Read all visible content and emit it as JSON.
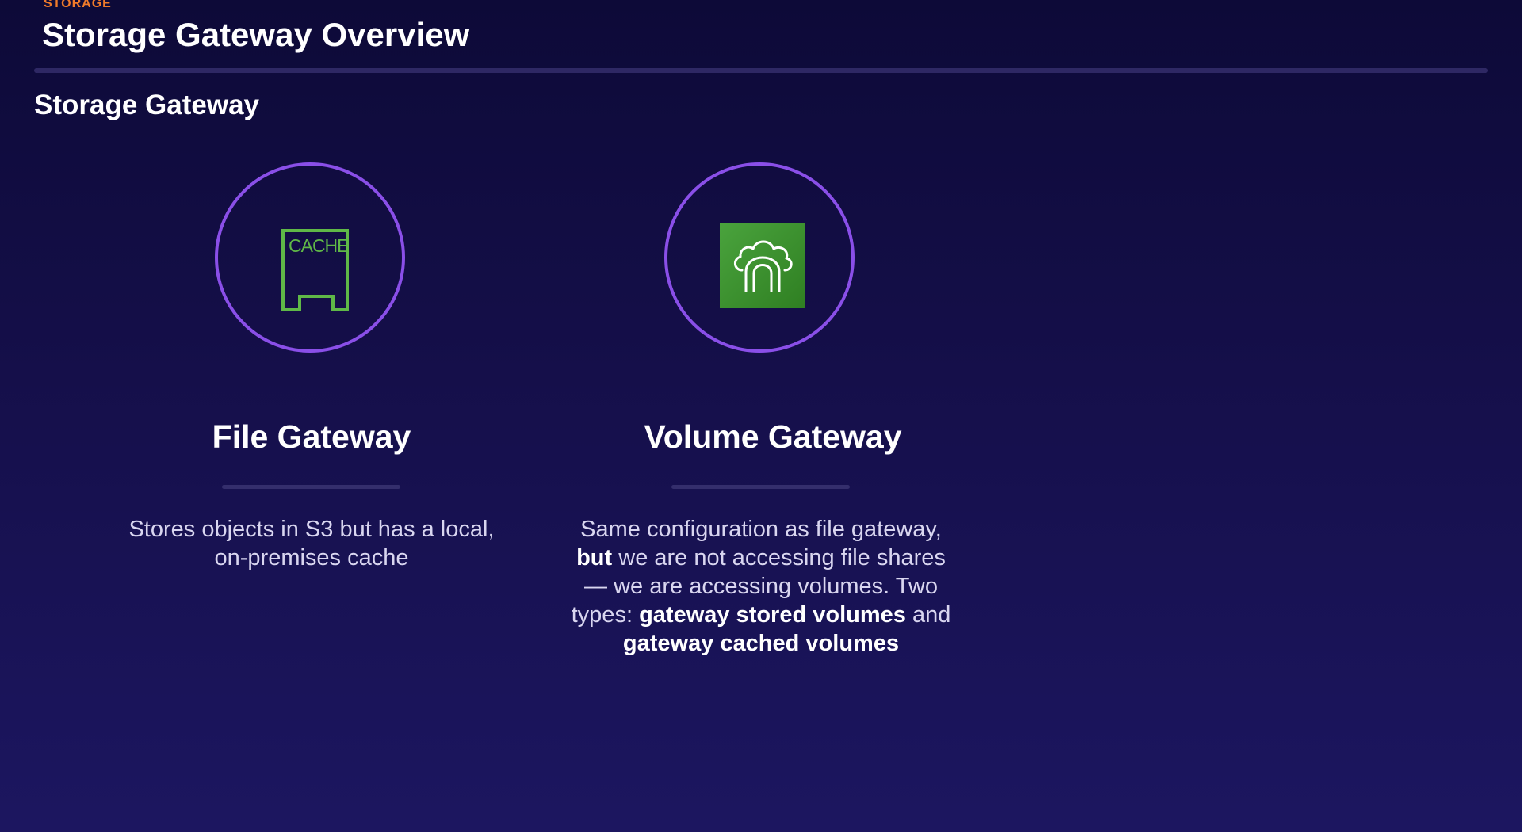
{
  "header": {
    "section_tag": "STORAGE",
    "title": "Storage Gateway Overview"
  },
  "section": {
    "heading": "Storage Gateway"
  },
  "cards": [
    {
      "title": "File Gateway",
      "icon": "cache-icon",
      "icon_text": "CACHE",
      "description": "Stores objects in S3 but has a local, on-premises cache"
    },
    {
      "title": "Volume Gateway",
      "icon": "cloud-gateway-icon",
      "description_parts": [
        "Same configuration as file gateway, ",
        "but",
        " we are not accessing file shares — we are accessing volumes. Two types: ",
        "gateway stored volumes",
        " and ",
        "gateway cached volumes"
      ]
    }
  ],
  "colors": {
    "background_top": "#0d0a38",
    "background_bottom": "#1c1660",
    "accent_orange": "#f07b2a",
    "circle_purple": "#8a4fe8",
    "icon_green": "#3f9b33"
  }
}
